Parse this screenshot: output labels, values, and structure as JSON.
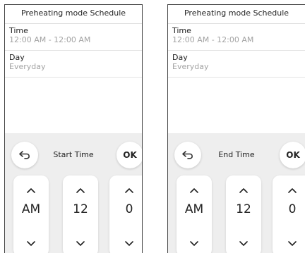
{
  "screens": [
    {
      "title": "Preheating mode Schedule",
      "time": {
        "label": "Time",
        "value": "12:00 AM - 12:00 AM"
      },
      "day": {
        "label": "Day",
        "value": "Everyday"
      },
      "panel": {
        "label": "Start Time",
        "ok_label": "OK",
        "back_icon": "back-arrow-icon",
        "wheels": [
          {
            "value": "AM"
          },
          {
            "value": "12"
          },
          {
            "value": "0"
          }
        ]
      }
    },
    {
      "title": "Preheating mode Schedule",
      "time": {
        "label": "Time",
        "value": "12:00 AM - 12:00 AM"
      },
      "day": {
        "label": "Day",
        "value": "Everyday"
      },
      "panel": {
        "label": "End Time",
        "ok_label": "OK",
        "back_icon": "back-arrow-icon",
        "wheels": [
          {
            "value": "AM"
          },
          {
            "value": "12"
          },
          {
            "value": "0"
          }
        ]
      }
    }
  ]
}
